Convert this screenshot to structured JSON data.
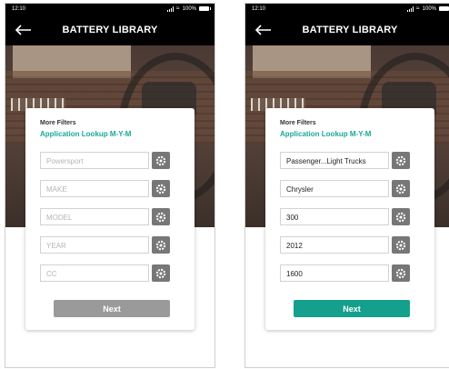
{
  "status_bar": {
    "left_time": "12:10",
    "right_time": "12:10",
    "battery_text": "100%"
  },
  "header": {
    "title": "BATTERY LIBRARY"
  },
  "colors": {
    "accent": "#1aa896",
    "next_enabled": "#14a08c",
    "next_disabled": "#9a9a9a",
    "gear_button": "#777777"
  },
  "screens": [
    {
      "more_filters_label": "More Filters",
      "lookup_label": "Application Lookup M-Y-M",
      "fields": [
        {
          "value": "",
          "placeholder": "Powersport"
        },
        {
          "value": "",
          "placeholder": "MAKE"
        },
        {
          "value": "",
          "placeholder": "MODEL"
        },
        {
          "value": "",
          "placeholder": "YEAR"
        },
        {
          "value": "",
          "placeholder": "CC"
        }
      ],
      "next_label": "Next",
      "next_state": "disabled"
    },
    {
      "more_filters_label": "More Filters",
      "lookup_label": "Application Lookup M-Y-M",
      "fields": [
        {
          "value": "Passenger...Light Trucks",
          "placeholder": ""
        },
        {
          "value": "Chrysler",
          "placeholder": ""
        },
        {
          "value": "300",
          "placeholder": ""
        },
        {
          "value": "2012",
          "placeholder": ""
        },
        {
          "value": "1600",
          "placeholder": ""
        }
      ],
      "next_label": "Next",
      "next_state": "enabled"
    }
  ],
  "icons": {
    "back": "back-arrow-icon",
    "gear": "gear-icon"
  }
}
